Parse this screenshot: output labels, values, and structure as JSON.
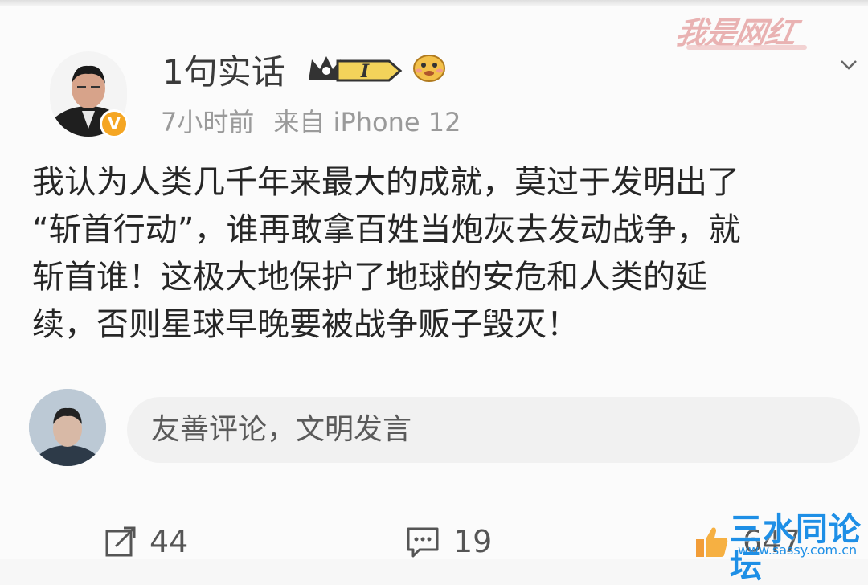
{
  "post": {
    "username": "1句实话",
    "level_badge": "I",
    "time": "7小时前",
    "source": "来自 iPhone 12",
    "lines": [
      "我认为人类几千年来最大的成就，莫过于发明出了",
      "“斩首行动”，谁再敢拿百姓当炮灰去发动战争，就",
      "斩首谁！这极大地保护了地球的安危和人类的延",
      "续，否则星球早晚要被战争贩子毁灭！"
    ]
  },
  "comment_box": {
    "placeholder": "友善评论，文明发言"
  },
  "actions": {
    "reposts": "44",
    "comments": "19",
    "likes": "647"
  },
  "watermarks": {
    "top": "我是网红",
    "bottom": "三水同论坛",
    "bottom_url": "www.sassy.com.cn"
  },
  "colors": {
    "verified": "#f5a623",
    "crown_gold": "#e0b431",
    "watermark_blue": "#1e8fe6"
  },
  "icons": [
    "verified-v-icon",
    "crown-badge-icon",
    "emoji-face-icon",
    "chevron-down-icon",
    "repost-icon",
    "comment-icon",
    "thumbs-up-icon"
  ]
}
